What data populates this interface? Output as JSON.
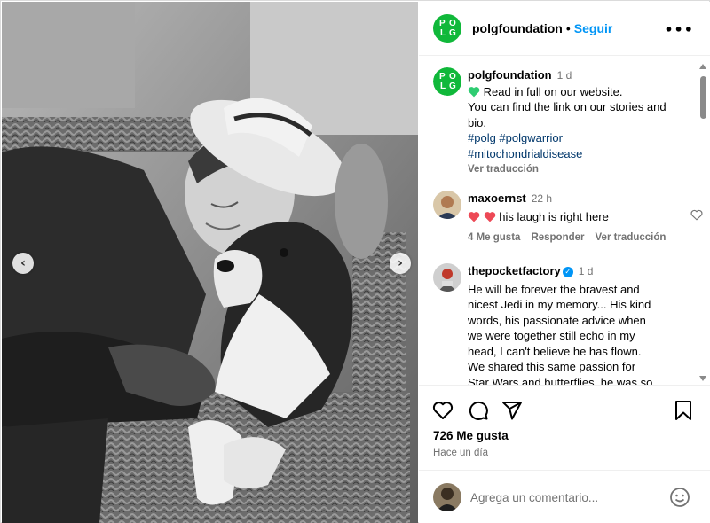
{
  "post": {
    "username": "polgfoundation",
    "separator": "•",
    "follow_label": "Seguir",
    "more_label": "•••",
    "logo_letters": [
      "P",
      "O",
      "L",
      "G"
    ],
    "likes": "726 Me gusta",
    "time": "Hace un día",
    "comment_placeholder": "Agrega un comentario..."
  },
  "caption": {
    "username": "polgfoundation",
    "time": "1 d",
    "lines": [
      "Read in full on our website.",
      "You can find the link on our stories and bio."
    ],
    "hashtags": "#polg #polgwarrior",
    "hashtags2": "#mitochondrialdisease",
    "translate": "Ver traducción"
  },
  "comments": [
    {
      "username": "maxoernst",
      "time": "22 h",
      "text": "his laugh is right here",
      "likes": "4 Me gusta",
      "reply": "Responder",
      "translate": "Ver traducción"
    },
    {
      "username": "thepocketfactory",
      "time": "1 d",
      "verified": true,
      "text": "He will be forever the bravest and nicest Jedi in my memory... His kind words, his passionate advice when we were together still echo in my head, I can't believe he has flown. We shared this same passion for Star Wars and butterflies, he was so"
    }
  ],
  "icons": {
    "prev": "chevron-left-icon",
    "next": "chevron-right-icon",
    "like": "heart-icon",
    "comment": "comment-icon",
    "share": "send-icon",
    "save": "bookmark-icon",
    "emoji": "emoji-icon"
  },
  "colors": {
    "accent": "#0095f6",
    "brand": "#10b83a",
    "hashtag": "#00376b",
    "heart": "#ed4956",
    "green_heart": "#2ecc71"
  }
}
